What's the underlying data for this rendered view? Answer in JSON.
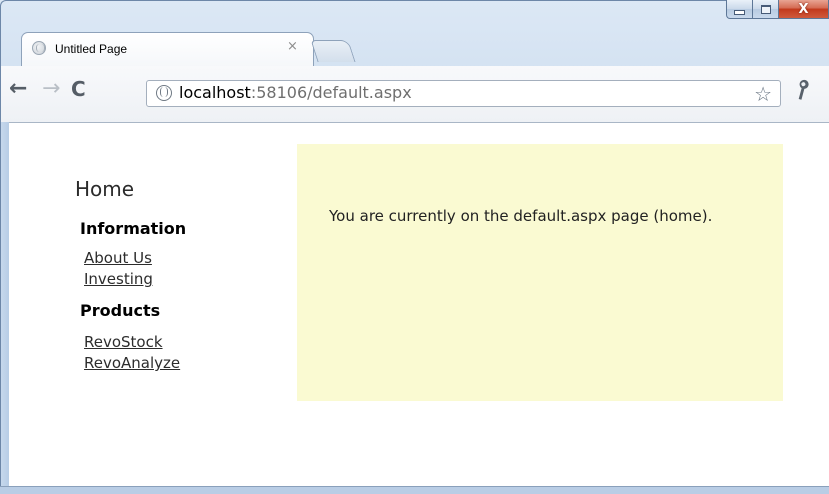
{
  "window": {
    "minimize_symbol": "–",
    "maximize_symbol": "□",
    "close_symbol": "X"
  },
  "tabs": [
    {
      "title": "Untitled Page",
      "close_symbol": "×",
      "icon": "globe-icon"
    }
  ],
  "toolbar": {
    "back_symbol": "←",
    "forward_symbol": "→",
    "reload_symbol": "C",
    "address": {
      "host": "localhost",
      "path": ":58106/default.aspx",
      "icon": "globe-icon"
    },
    "bookmark_symbol": "☆",
    "wrench_symbol": "🔧"
  },
  "sidebar": {
    "heading": "Home",
    "sections": [
      {
        "title": "Information",
        "links": [
          "About Us",
          "Investing"
        ]
      },
      {
        "title": "Products",
        "links": [
          "RevoStock",
          "RevoAnalyze"
        ]
      }
    ]
  },
  "main": {
    "text": "You are currently on the default.aspx page (home).",
    "panel_color": "#fafad2"
  }
}
